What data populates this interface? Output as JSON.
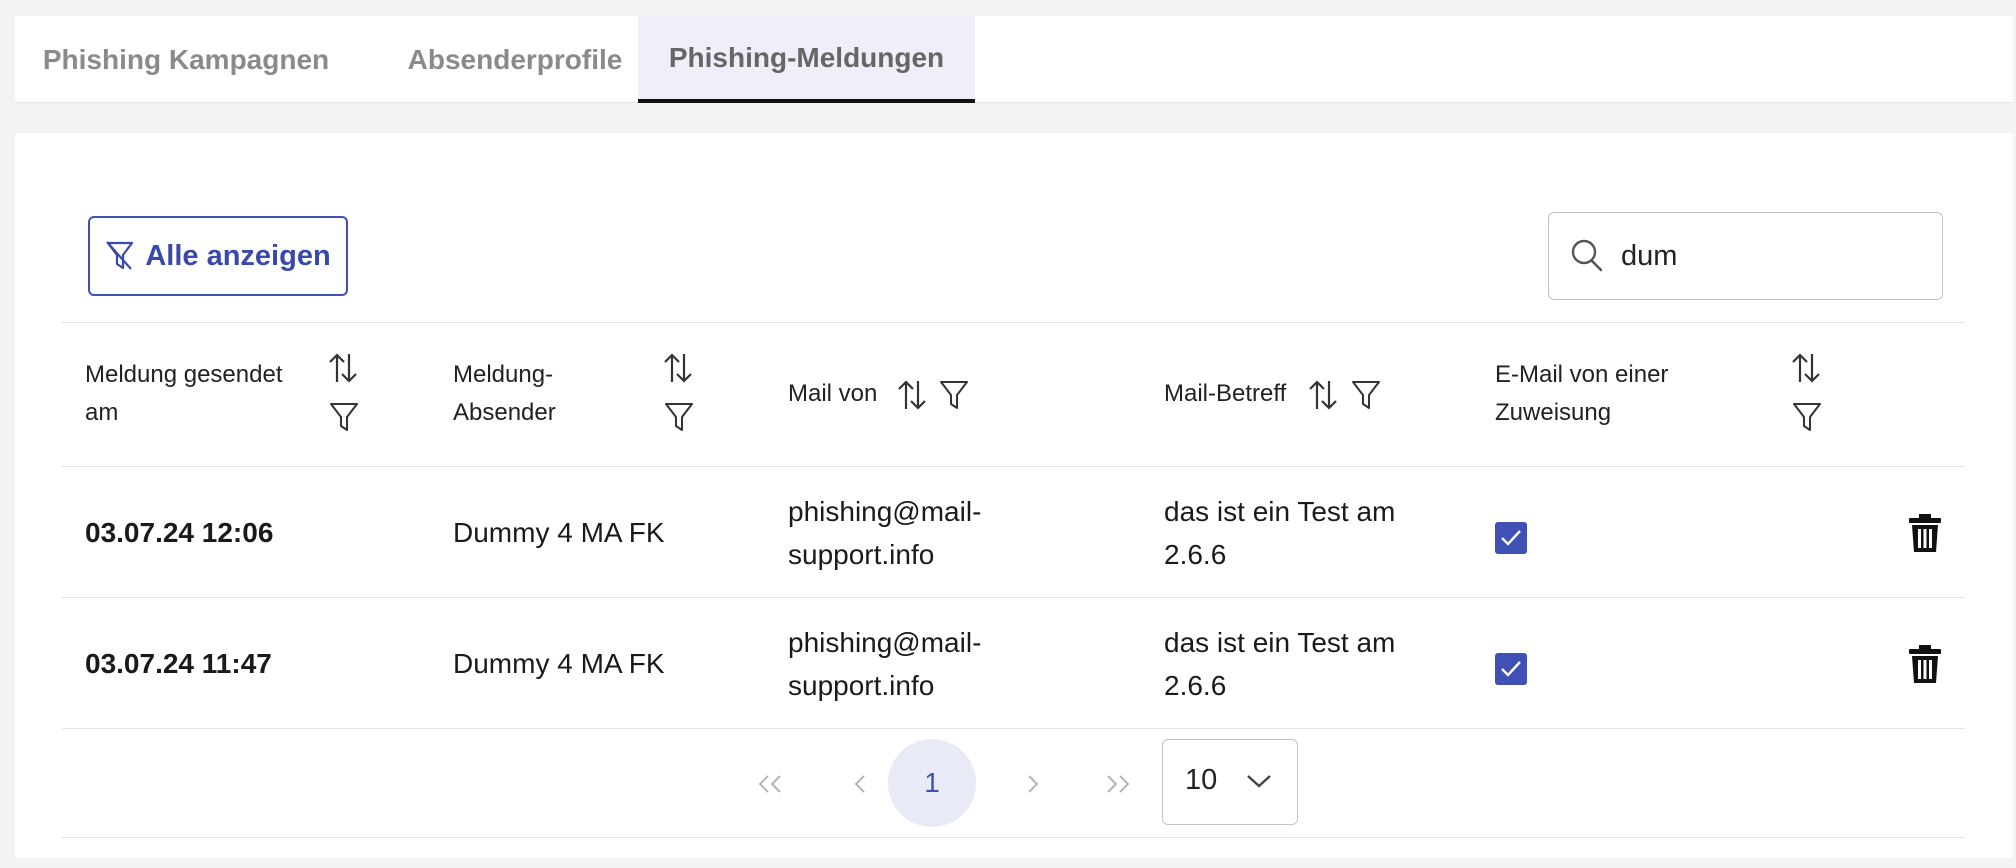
{
  "tabs": [
    {
      "label": "Phishing Kampagnen"
    },
    {
      "label": "Absenderprofile"
    },
    {
      "label": "Phishing-Meldungen"
    }
  ],
  "toolbar": {
    "show_all_label": "Alle anzeigen",
    "search_value": "dum"
  },
  "table": {
    "columns": [
      {
        "label_line1": "Meldung gesendet",
        "label_line2": "am"
      },
      {
        "label_line1": "Meldung-",
        "label_line2": "Absender"
      },
      {
        "label": "Mail von"
      },
      {
        "label": "Mail-Betreff"
      },
      {
        "label_line1": "E-Mail von einer",
        "label_line2": "Zuweisung"
      }
    ],
    "rows": [
      {
        "sent_at": "03.07.24 12:06",
        "sender": "Dummy 4 MA FK",
        "mail_from_line1": "phishing@mail-",
        "mail_from_line2": "support.info",
        "subject_line1": "das ist ein Test am",
        "subject_line2": "2.6.6",
        "assignment_checked": true
      },
      {
        "sent_at": "03.07.24 11:47",
        "sender": "Dummy 4 MA FK",
        "mail_from_line1": "phishing@mail-",
        "mail_from_line2": "support.info",
        "subject_line1": "das ist ein Test am",
        "subject_line2": "2.6.6",
        "assignment_checked": true
      }
    ]
  },
  "pagination": {
    "first": "«",
    "prev": "‹",
    "current_page": "1",
    "next": "›",
    "last": "»",
    "page_size": "10"
  },
  "colors": {
    "accent": "#3f51b5",
    "tab_active_bg": "#eeeff8"
  }
}
